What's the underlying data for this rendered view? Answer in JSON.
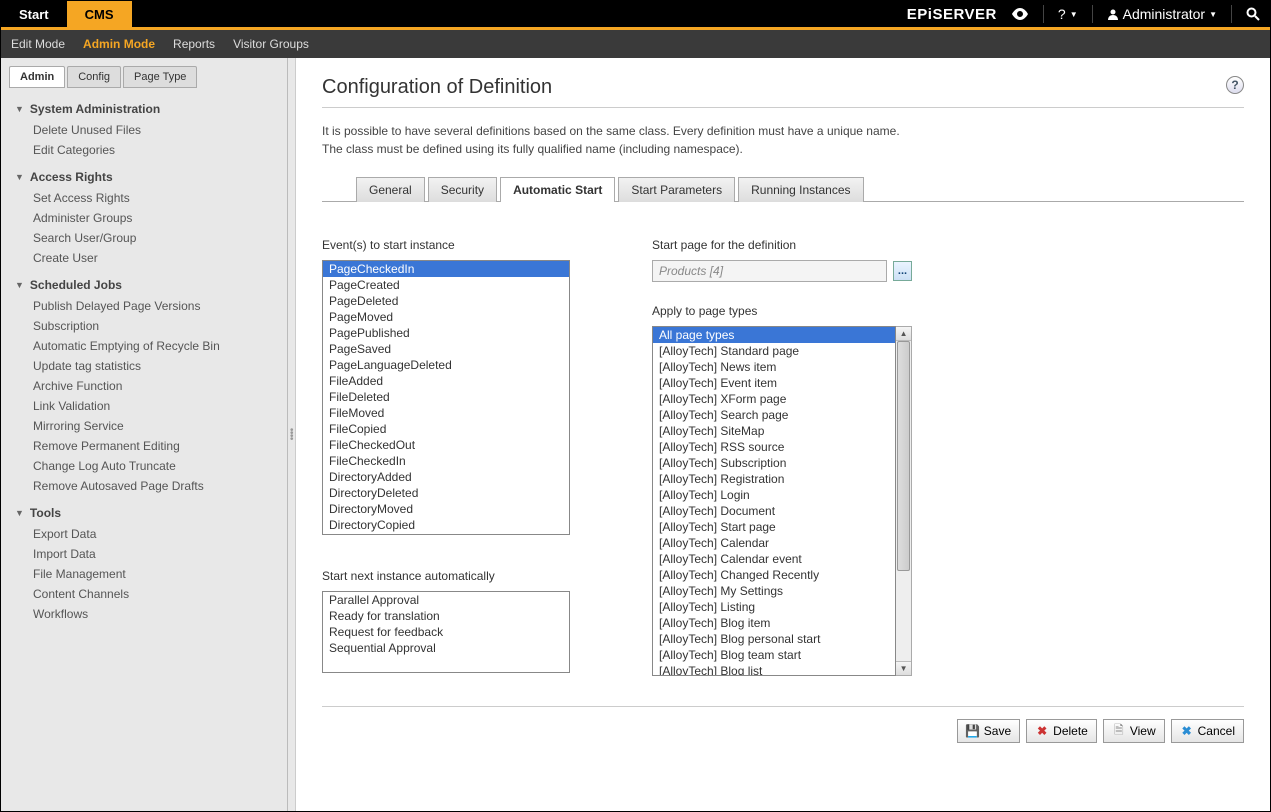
{
  "topbar": {
    "start": "Start",
    "cms": "CMS",
    "brand": "EPiSERVER",
    "user_label": "Administrator",
    "help": "?"
  },
  "subnav": {
    "items": [
      "Edit Mode",
      "Admin Mode",
      "Reports",
      "Visitor Groups"
    ],
    "active": 1
  },
  "admin_tabs": {
    "items": [
      "Admin",
      "Config",
      "Page Type"
    ],
    "active": 0
  },
  "sidebar": [
    {
      "title": "System Administration",
      "items": [
        "Delete Unused Files",
        "Edit Categories"
      ]
    },
    {
      "title": "Access Rights",
      "items": [
        "Set Access Rights",
        "Administer Groups",
        "Search User/Group",
        "Create User"
      ]
    },
    {
      "title": "Scheduled Jobs",
      "items": [
        "Publish Delayed Page Versions",
        "Subscription",
        "Automatic Emptying of Recycle Bin",
        "Update tag statistics",
        "Archive Function",
        "Link Validation",
        "Mirroring Service",
        "Remove Permanent Editing",
        "Change Log Auto Truncate",
        "Remove Autosaved Page Drafts"
      ]
    },
    {
      "title": "Tools",
      "items": [
        "Export Data",
        "Import Data",
        "File Management",
        "Content Channels",
        "Workflows"
      ]
    }
  ],
  "page": {
    "title": "Configuration of Definition",
    "desc1": "It is possible to have several definitions based on the same class. Every definition must have a unique name.",
    "desc2": "The class must be defined using its fully qualified name (including namespace)."
  },
  "section_tabs": {
    "items": [
      "General",
      "Security",
      "Automatic Start",
      "Start Parameters",
      "Running Instances"
    ],
    "active": 2
  },
  "events": {
    "label": "Event(s) to start instance",
    "items": [
      "PageCheckedIn",
      "PageCreated",
      "PageDeleted",
      "PageMoved",
      "PagePublished",
      "PageSaved",
      "PageLanguageDeleted",
      "FileAdded",
      "FileDeleted",
      "FileMoved",
      "FileCopied",
      "FileCheckedOut",
      "FileCheckedIn",
      "DirectoryAdded",
      "DirectoryDeleted",
      "DirectoryMoved",
      "DirectoryCopied"
    ],
    "selected": 0
  },
  "next_instance": {
    "label": "Start next instance automatically",
    "items": [
      "Parallel Approval",
      "Ready for translation",
      "Request for feedback",
      "Sequential Approval"
    ]
  },
  "startpage": {
    "label": "Start page for the definition",
    "value": "Products [4]",
    "browse": "..."
  },
  "page_types": {
    "label": "Apply to page types",
    "items": [
      "All page types",
      "[AlloyTech] Standard page",
      "[AlloyTech] News item",
      "[AlloyTech] Event item",
      "[AlloyTech] XForm page",
      "[AlloyTech] Search page",
      "[AlloyTech] SiteMap",
      "[AlloyTech] RSS source",
      "[AlloyTech] Subscription",
      "[AlloyTech] Registration",
      "[AlloyTech] Login",
      "[AlloyTech] Document",
      "[AlloyTech] Start page",
      "[AlloyTech] Calendar",
      "[AlloyTech] Calendar event",
      "[AlloyTech] Changed Recently",
      "[AlloyTech] My Settings",
      "[AlloyTech] Listing",
      "[AlloyTech] Blog item",
      "[AlloyTech] Blog personal start",
      "[AlloyTech] Blog team start",
      "[AlloyTech] Blog list"
    ],
    "selected": 0
  },
  "buttons": {
    "save": "Save",
    "delete": "Delete",
    "view": "View",
    "cancel": "Cancel"
  }
}
